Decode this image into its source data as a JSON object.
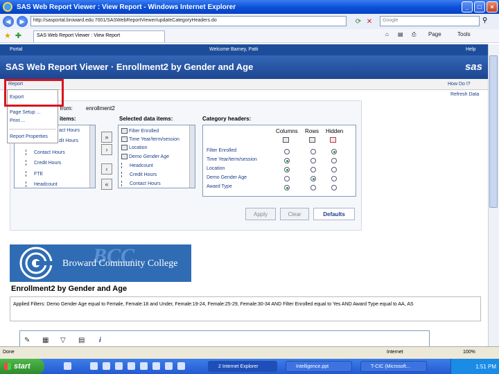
{
  "window": {
    "title": "SAS Web Report Viewer : View Report - Windows Internet Explorer"
  },
  "browser": {
    "address": "http://sasportal.broward.edu:7001/SASWebReportViewer/updateCategoryHeaders.do",
    "search_placeholder": "Google",
    "tab_label": "SAS Web Report Viewer : View Report",
    "page_menu": "Page",
    "tools_menu": "Tools"
  },
  "sas_nav": {
    "portal": "Portal",
    "welcome": "Welcome Barney, Patti",
    "help": "Help"
  },
  "banner": {
    "title": "SAS Web Report Viewer  ·  Enrollment2 by Gender and Age",
    "logo": "sas"
  },
  "menubar": {
    "report": "Report",
    "howdoi": "How Do I?",
    "refresh": "Refresh Data"
  },
  "report_menu": {
    "items": [
      "Export",
      "Page Setup ...",
      "Print ...",
      "Report Properties"
    ]
  },
  "panel": {
    "from_label": "d from:",
    "from_value": "enrollment2",
    "available_label": "items:",
    "selected_label": "Selected data items:",
    "category_label": "Category headers:",
    "available_items": [
      "act Hours",
      "dit Hours",
      "Contact Hours",
      "Credit Hours",
      "FTE",
      "Headcount"
    ],
    "selected_items": [
      "Filter Enrolled",
      "Time Year/term/session",
      "Location",
      "Demo Gender Age",
      "Headcount",
      "Credit Hours",
      "Contact Hours"
    ],
    "col_headers": [
      "Columns",
      "Rows",
      "Hidden"
    ],
    "category_rows": [
      {
        "label": "Filter Enrolled",
        "sel": 2
      },
      {
        "label": "Time Year/term/session",
        "sel": 0
      },
      {
        "label": "Location",
        "sel": 0
      },
      {
        "label": "Demo Gender Age",
        "sel": 1
      },
      {
        "label": "Award Type",
        "sel": 0
      }
    ],
    "buttons": {
      "apply": "Apply",
      "clear": "Clear",
      "defaults": "Defaults"
    }
  },
  "report": {
    "college": "Broward Community College",
    "watermark": "BCC",
    "title": "Enrollment2 by Gender and Age",
    "filters": "Applied Filters:  Demo Gender Age equal to Female, Female:18 and Under, Female:19-24, Female:25-29, Female:30-34  AND  Filter Enrolled equal to Yes  AND  Award Type equal to AA, AS"
  },
  "status": {
    "left": "Done",
    "zone": "Internet",
    "zoom": "100%"
  },
  "taskbar": {
    "start": "start",
    "items": [
      "2 Internet Explorer",
      "Intelligence.ppt",
      "T-CIC (Microsoft..."
    ],
    "time": "1:51 PM"
  }
}
